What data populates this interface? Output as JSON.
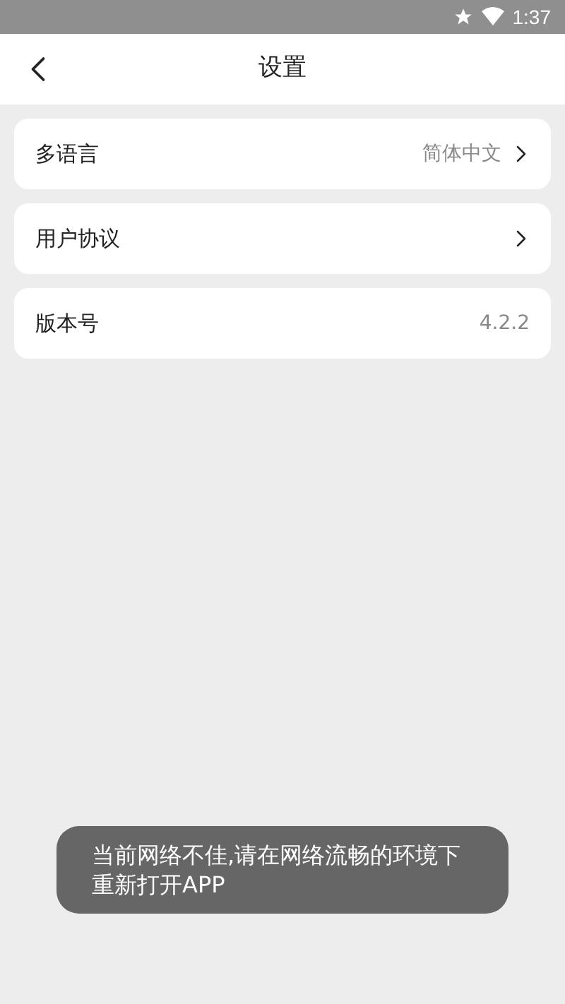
{
  "status_bar": {
    "time": "1:37"
  },
  "header": {
    "title": "设置"
  },
  "rows": [
    {
      "label": "多语言",
      "value": "简体中文",
      "chevron": true
    },
    {
      "label": "用户协议",
      "chevron": true
    },
    {
      "label": "版本号",
      "value": "4.2.2",
      "chevron": false
    }
  ],
  "toast": {
    "text": "当前网络不佳,请在网络流畅的环境下重新打开APP"
  }
}
